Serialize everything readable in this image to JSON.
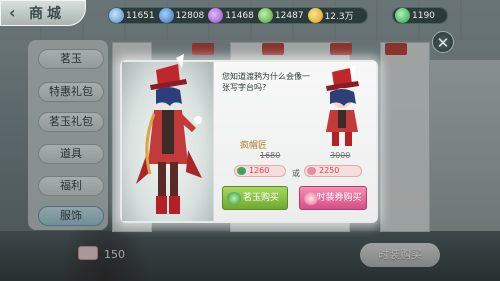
{
  "header": {
    "title": "商城"
  },
  "currencies": [
    {
      "icon": "diamond-icon",
      "value": "11651"
    },
    {
      "icon": "blue-flower-icon",
      "value": "12808"
    },
    {
      "icon": "purple-flower-icon",
      "value": "11468"
    },
    {
      "icon": "green-gem-icon",
      "value": "12487"
    },
    {
      "icon": "gold-coin-icon",
      "value": "12.3万"
    }
  ],
  "jade": {
    "icon": "jade-icon",
    "value": "1190"
  },
  "sidebar": {
    "tabs": [
      {
        "label": "茗玉"
      },
      {
        "label": "特惠礼包"
      },
      {
        "label": "茗玉礼包"
      },
      {
        "label": "道具"
      },
      {
        "label": "福利"
      },
      {
        "label": "服饰",
        "active": true
      }
    ]
  },
  "modal": {
    "question": "您知道渡鸦为什么会像一张写字台吗？",
    "item_name": "疯帽匠",
    "original_price_jade": "1680",
    "original_price_ticket": "3000",
    "price_jade": "1260",
    "price_ticket": "2250",
    "or_label": "或",
    "buy_jade_label": "茗玉购买",
    "buy_ticket_label": "时装券购买"
  },
  "footer": {
    "price": "150",
    "buy_all_label": "时装购买"
  },
  "colors": {
    "accent_green": "#6ea830",
    "accent_pink": "#d54f86",
    "price_red": "#dd4444"
  }
}
